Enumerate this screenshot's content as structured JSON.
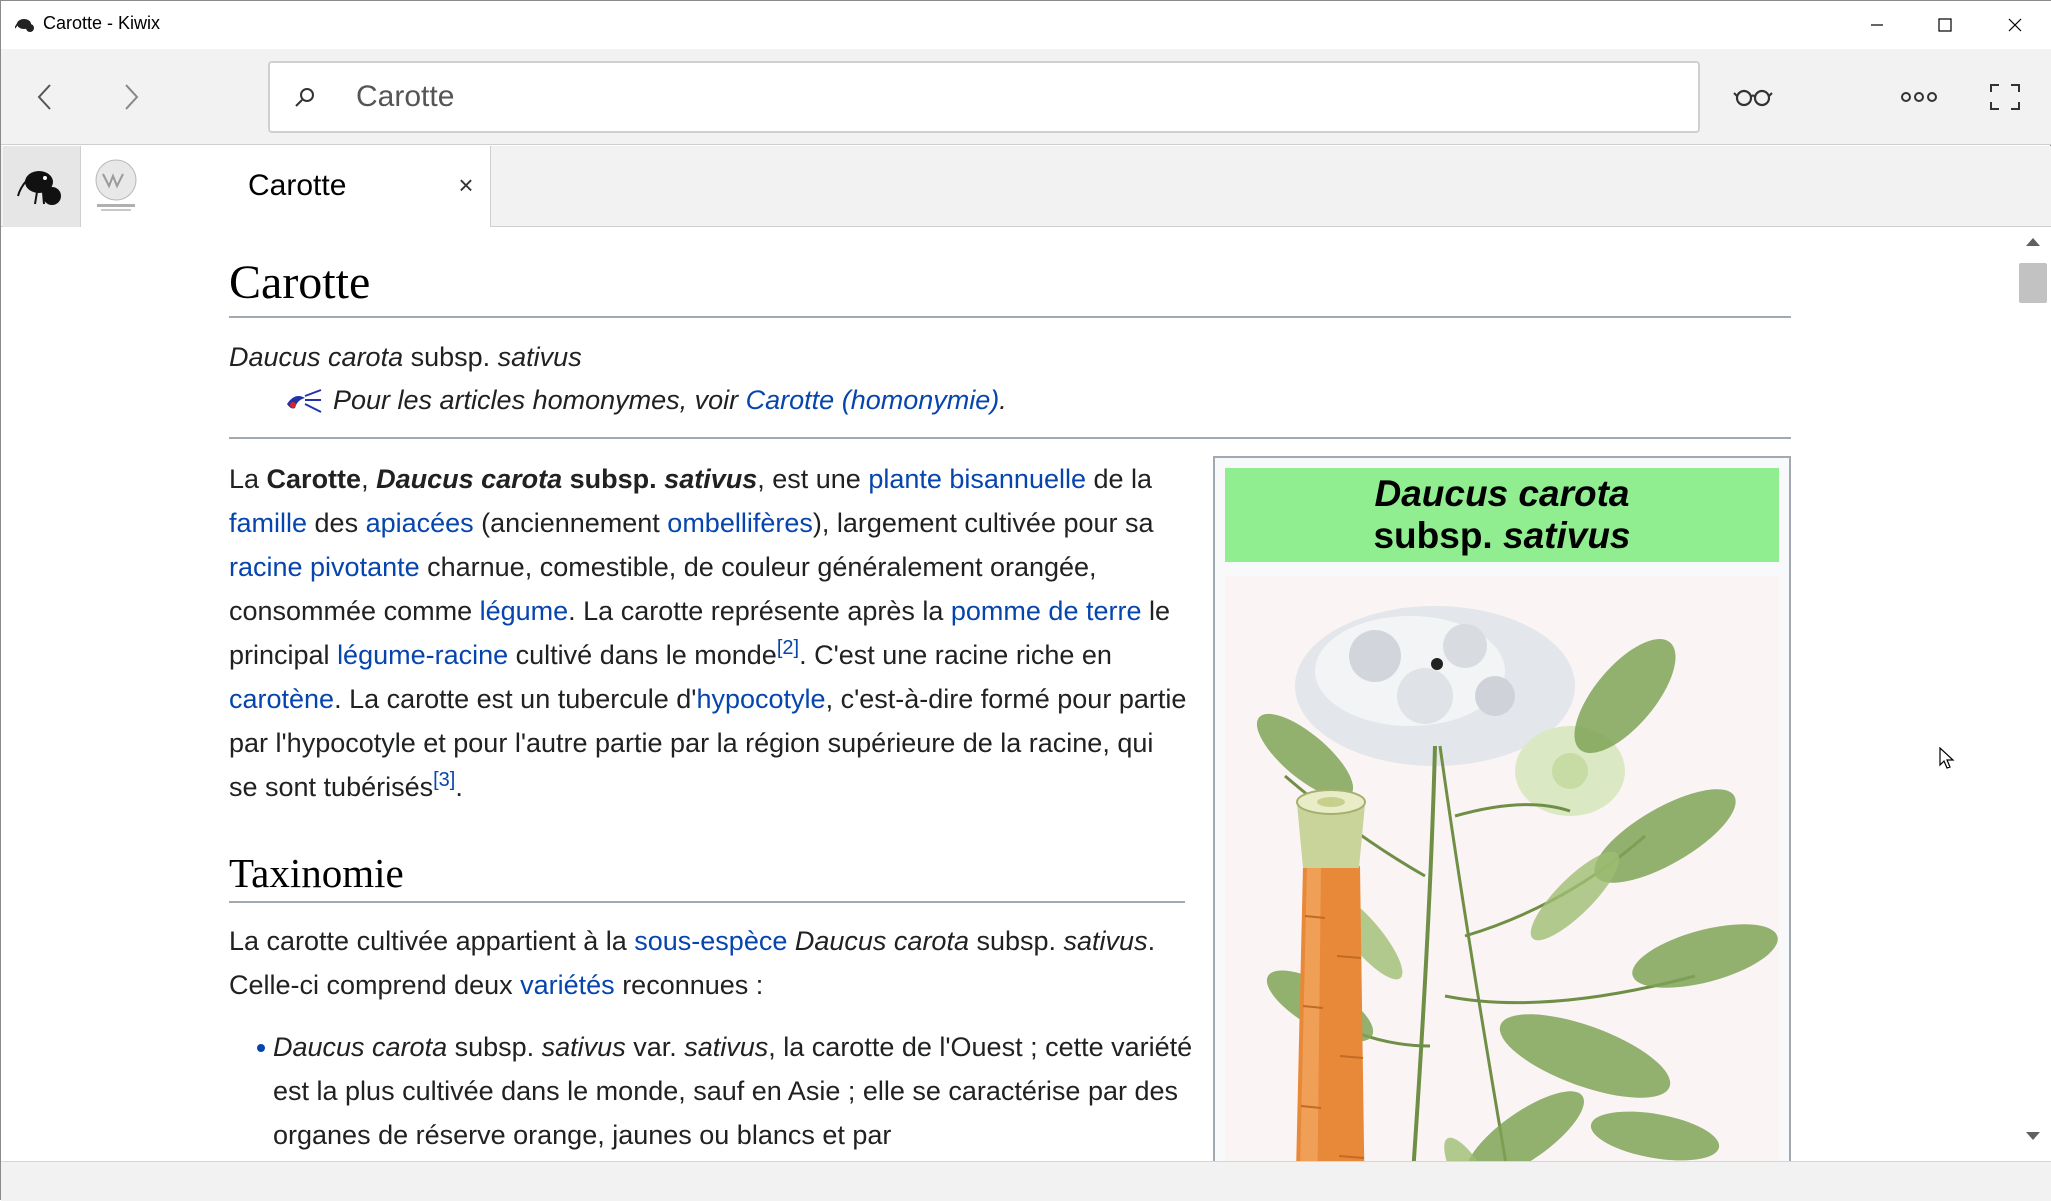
{
  "window": {
    "title": "Carotte - Kiwix"
  },
  "toolbar": {
    "search_value": "Carotte",
    "icons": [
      "back-arrow-icon",
      "forward-arrow-icon",
      "search-icon",
      "reading-glasses-icon",
      "more-options-icon",
      "fullscreen-icon"
    ]
  },
  "tabs": {
    "active_title": "Carotte",
    "close_glyph": "×"
  },
  "article": {
    "title": "Carotte",
    "subtitle": {
      "genus_species": "Daucus carota",
      "rank": " subsp. ",
      "epithet": "sativus"
    },
    "hatnote": {
      "prefix": "Pour les articles homonymes, voir ",
      "link": "Carotte (homonymie)",
      "suffix": "."
    },
    "intro": {
      "t1": "La ",
      "b1": "Carotte",
      "t2": ", ",
      "bi1": "Daucus carota",
      "b2": " subsp. ",
      "bi2": "sativus",
      "t3": ", est une ",
      "l1": "plante bisannuelle",
      "t4": " de la ",
      "l2": "famille",
      "t5": " des ",
      "l3": "apiacées",
      "t6": " (anciennement ",
      "l4": "ombellifères",
      "t7": "), largement cultivée pour sa ",
      "l5": "racine pivotante",
      "t8": " charnue, comestible, de couleur généralement orangée, consommée comme ",
      "l6": "légume",
      "t9": ". La carotte représente après la ",
      "l7": "pomme de terre",
      "t10": " le principal ",
      "l8": "légume-racine",
      "t11": " cultivé dans le monde",
      "ref1": "[2]",
      "t12": ". C'est une racine riche en ",
      "l9": "carotène",
      "t13": ". La carotte est un tubercule d'",
      "l10": "hypocotyle",
      "t14": ", c'est-à-dire formé pour partie par l'hypocotyle et pour l'autre partie par la région supérieure de la racine, qui se sont tubérisés",
      "ref2": "[3]",
      "t15": "."
    },
    "taxonomy": {
      "heading": "Taxinomie",
      "p_t1": "La carotte cultivée appartient à la ",
      "p_l1": "sous-espèce",
      "p_t2": " ",
      "p_i1": "Daucus carota",
      "p_t3": " subsp. ",
      "p_i2": "sativus",
      "p_t4": ". Celle-ci comprend deux ",
      "p_l2": "variétés",
      "p_t5": " reconnues :",
      "item1": {
        "i1": "Daucus carota",
        "t1": " subsp. ",
        "i2": "sativus",
        "t2": " var. ",
        "i3": "sativus",
        "t3": ", la carotte de l'Ouest ; cette variété est la plus cultivée dans le monde, sauf en Asie ; elle se caractérise par des organes de réserve orange, jaunes ou blancs et par"
      }
    },
    "infobox": {
      "title_line1": "Daucus carota",
      "title_line2_a": "subsp. ",
      "title_line2_b": "sativus",
      "header_color": "#90ee90"
    }
  },
  "colors": {
    "link": "#0645ad",
    "text": "#202122",
    "chrome": "#f2f2f2"
  }
}
